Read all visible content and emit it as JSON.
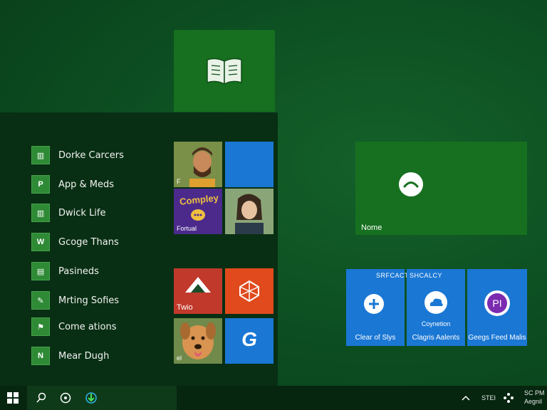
{
  "top_tile": {
    "icon": "book-icon"
  },
  "menu_items": [
    {
      "label": "Dorke Carcers",
      "icon_glyph": "▥"
    },
    {
      "label": "App & Meds",
      "icon_glyph": "P"
    },
    {
      "label": "Dwick Life",
      "icon_glyph": "▥"
    },
    {
      "label": "Gcoge Thans",
      "icon_glyph": "W"
    },
    {
      "label": "Pasineds",
      "icon_glyph": "▤"
    },
    {
      "label": "Mrting Sofies",
      "icon_glyph": "✎"
    },
    {
      "label": "Come ations",
      "icon_glyph": "⚑"
    },
    {
      "label": "Mear Dugh",
      "icon_glyph": "N"
    }
  ],
  "tiles": {
    "person1_label": "F",
    "compay_label": "Fortual",
    "compay_title": "Compley",
    "twio_label": "Twio",
    "dog_label": "el",
    "g_glyph": "G",
    "nome_label": "Nome"
  },
  "blue_tiles": {
    "clear": {
      "head": "SRFCACT",
      "foot": "Clear of Slys"
    },
    "clagris": {
      "head": "SHCALCY",
      "sub": "Coynetion",
      "foot": "Clagris Aalents"
    },
    "feed": {
      "glyph": "PI",
      "foot": "Geegs Feed Malis"
    }
  },
  "taskbar": {
    "tray_label": "STEI",
    "time": "SC PM",
    "date": "Aegnil"
  }
}
